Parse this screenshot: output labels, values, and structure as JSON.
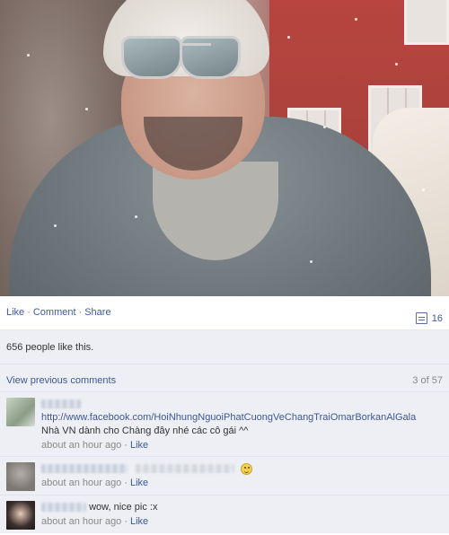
{
  "actions": {
    "like": "Like",
    "comment": "Comment",
    "share": "Share",
    "separator": "·",
    "share_count": "16",
    "share_icon": "shares-icon"
  },
  "likes_text": "656 people like this.",
  "previous": {
    "label": "View previous comments",
    "count": "3 of 57"
  },
  "comments": [
    {
      "text_line1": "http://www.facebook.com/HoiNhungNguoiPhatCuongVeChangTraiOmarBorkanAlGala",
      "text_line2": "Nhà VN dành cho Chàng đây nhé các cô gái ^^",
      "time": "about an hour ago",
      "like": "Like"
    },
    {
      "time": "about an hour ago",
      "like": "Like",
      "emoji": "smile-icon"
    },
    {
      "text": "wow, nice pic :x",
      "time": "about an hour ago",
      "like": "Like"
    }
  ],
  "colors": {
    "link": "#3b5998",
    "ufi_bg": "#edeff4",
    "meta": "#888888"
  }
}
